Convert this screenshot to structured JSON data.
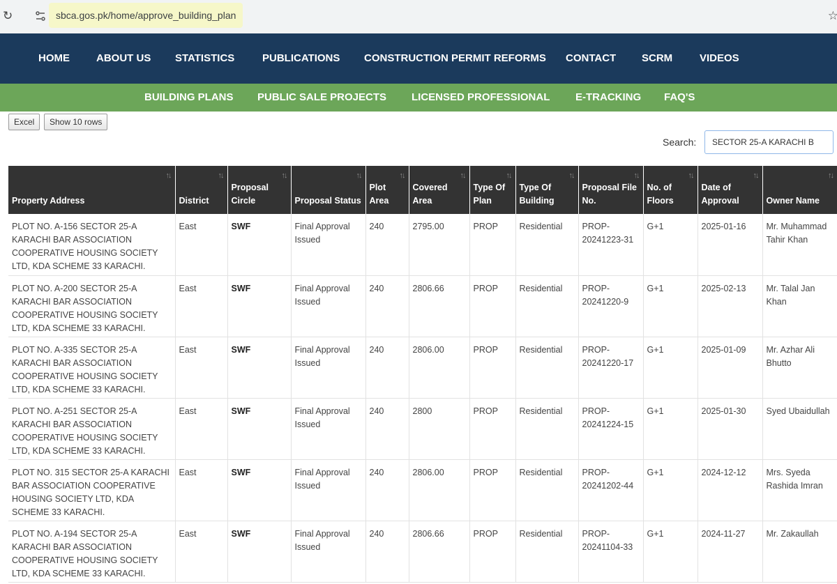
{
  "browser": {
    "url": "sbca.gos.pk/home/approve_building_plan"
  },
  "nav": {
    "home": "HOME",
    "about": "ABOUT US",
    "statistics": "STATISTICS",
    "publications": "PUBLICATIONS",
    "reforms": "CONSTRUCTION PERMIT REFORMS",
    "contact": "CONTACT",
    "scrm": "SCRM",
    "videos": "VIDEOS"
  },
  "subnav": {
    "building_plans": "BUILDING PLANS",
    "public_sale": "PUBLIC SALE PROJECTS",
    "licensed": "LICENSED PROFESSIONAL",
    "etracking": "E-TRACKING",
    "faqs": "FAQ'S"
  },
  "controls": {
    "excel": "Excel",
    "show_rows": "Show 10 rows",
    "search_label": "Search:",
    "search_value": "SECTOR 25-A KARACHI B"
  },
  "table": {
    "headers": {
      "address": "Property Address",
      "district": "District",
      "circle": "Proposal Circle",
      "status": "Proposal Status",
      "plot": "Plot Area",
      "covered": "Covered Area",
      "plan": "Type Of Plan",
      "building": "Type Of Building",
      "file": "Proposal File No.",
      "floors": "No. of Floors",
      "date": "Date of Approval",
      "owner": "Owner Name"
    },
    "rows": [
      {
        "address": "PLOT NO. A-156 SECTOR 25-A KARACHI BAR ASSOCIATION COOPERATIVE HOUSING SOCIETY LTD, KDA SCHEME 33 KARACHI.",
        "district": "East",
        "circle": "SWF",
        "status": "Final Approval Issued",
        "plot": "240",
        "covered": "2795.00",
        "plan": "PROP",
        "building": "Residential",
        "file": "PROP-20241223-31",
        "floors": "G+1",
        "date": "2025-01-16",
        "owner": "Mr. Muhammad Tahir Khan"
      },
      {
        "address": "PLOT NO. A-200 SECTOR 25-A KARACHI BAR ASSOCIATION COOPERATIVE HOUSING SOCIETY LTD, KDA SCHEME 33 KARACHI.",
        "district": "East",
        "circle": "SWF",
        "status": "Final Approval Issued",
        "plot": "240",
        "covered": "2806.66",
        "plan": "PROP",
        "building": "Residential",
        "file": "PROP-20241220-9",
        "floors": "G+1",
        "date": "2025-02-13",
        "owner": "Mr. Talal Jan Khan"
      },
      {
        "address": "PLOT NO. A-335 SECTOR 25-A KARACHI BAR ASSOCIATION COOPERATIVE HOUSING SOCIETY LTD, KDA SCHEME 33 KARACHI.",
        "district": "East",
        "circle": "SWF",
        "status": "Final Approval Issued",
        "plot": "240",
        "covered": "2806.00",
        "plan": "PROP",
        "building": "Residential",
        "file": "PROP-20241220-17",
        "floors": "G+1",
        "date": "2025-01-09",
        "owner": "Mr. Azhar Ali Bhutto"
      },
      {
        "address": "PLOT NO. A-251 SECTOR 25-A KARACHI BAR ASSOCIATION COOPERATIVE HOUSING SOCIETY LTD, KDA SCHEME 33 KARACHI.",
        "district": "East",
        "circle": "SWF",
        "status": "Final Approval Issued",
        "plot": "240",
        "covered": "2800",
        "plan": "PROP",
        "building": "Residential",
        "file": "PROP-20241224-15",
        "floors": "G+1",
        "date": "2025-01-30",
        "owner": "Syed Ubaidullah"
      },
      {
        "address": "PLOT NO. 315 SECTOR 25-A KARACHI BAR ASSOCIATION COOPERATIVE HOUSING SOCIETY LTD, KDA SCHEME 33 KARACHI.",
        "district": "East",
        "circle": "SWF",
        "status": "Final Approval Issued",
        "plot": "240",
        "covered": "2806.00",
        "plan": "PROP",
        "building": "Residential",
        "file": "PROP-20241202-44",
        "floors": "G+1",
        "date": "2024-12-12",
        "owner": "Mrs. Syeda Rashida Imran"
      },
      {
        "address": "PLOT NO. A-194 SECTOR 25-A KARACHI BAR ASSOCIATION COOPERATIVE HOUSING SOCIETY LTD, KDA SCHEME 33 KARACHI.",
        "district": "East",
        "circle": "SWF",
        "status": "Final Approval Issued",
        "plot": "240",
        "covered": "2806.66",
        "plan": "PROP",
        "building": "Residential",
        "file": "PROP-20241104-33",
        "floors": "G+1",
        "date": "2024-11-27",
        "owner": "Mr. Zakaullah"
      }
    ]
  },
  "colors": {
    "main_nav_bg": "#1b3a5c",
    "sub_nav_bg": "#6ca659",
    "table_header_bg": "#333333"
  },
  "icons": {
    "reload": "reload-icon",
    "site_info": "site-info-icon",
    "sort": "sort-icon",
    "bookmark": "bookmark-star-icon"
  }
}
